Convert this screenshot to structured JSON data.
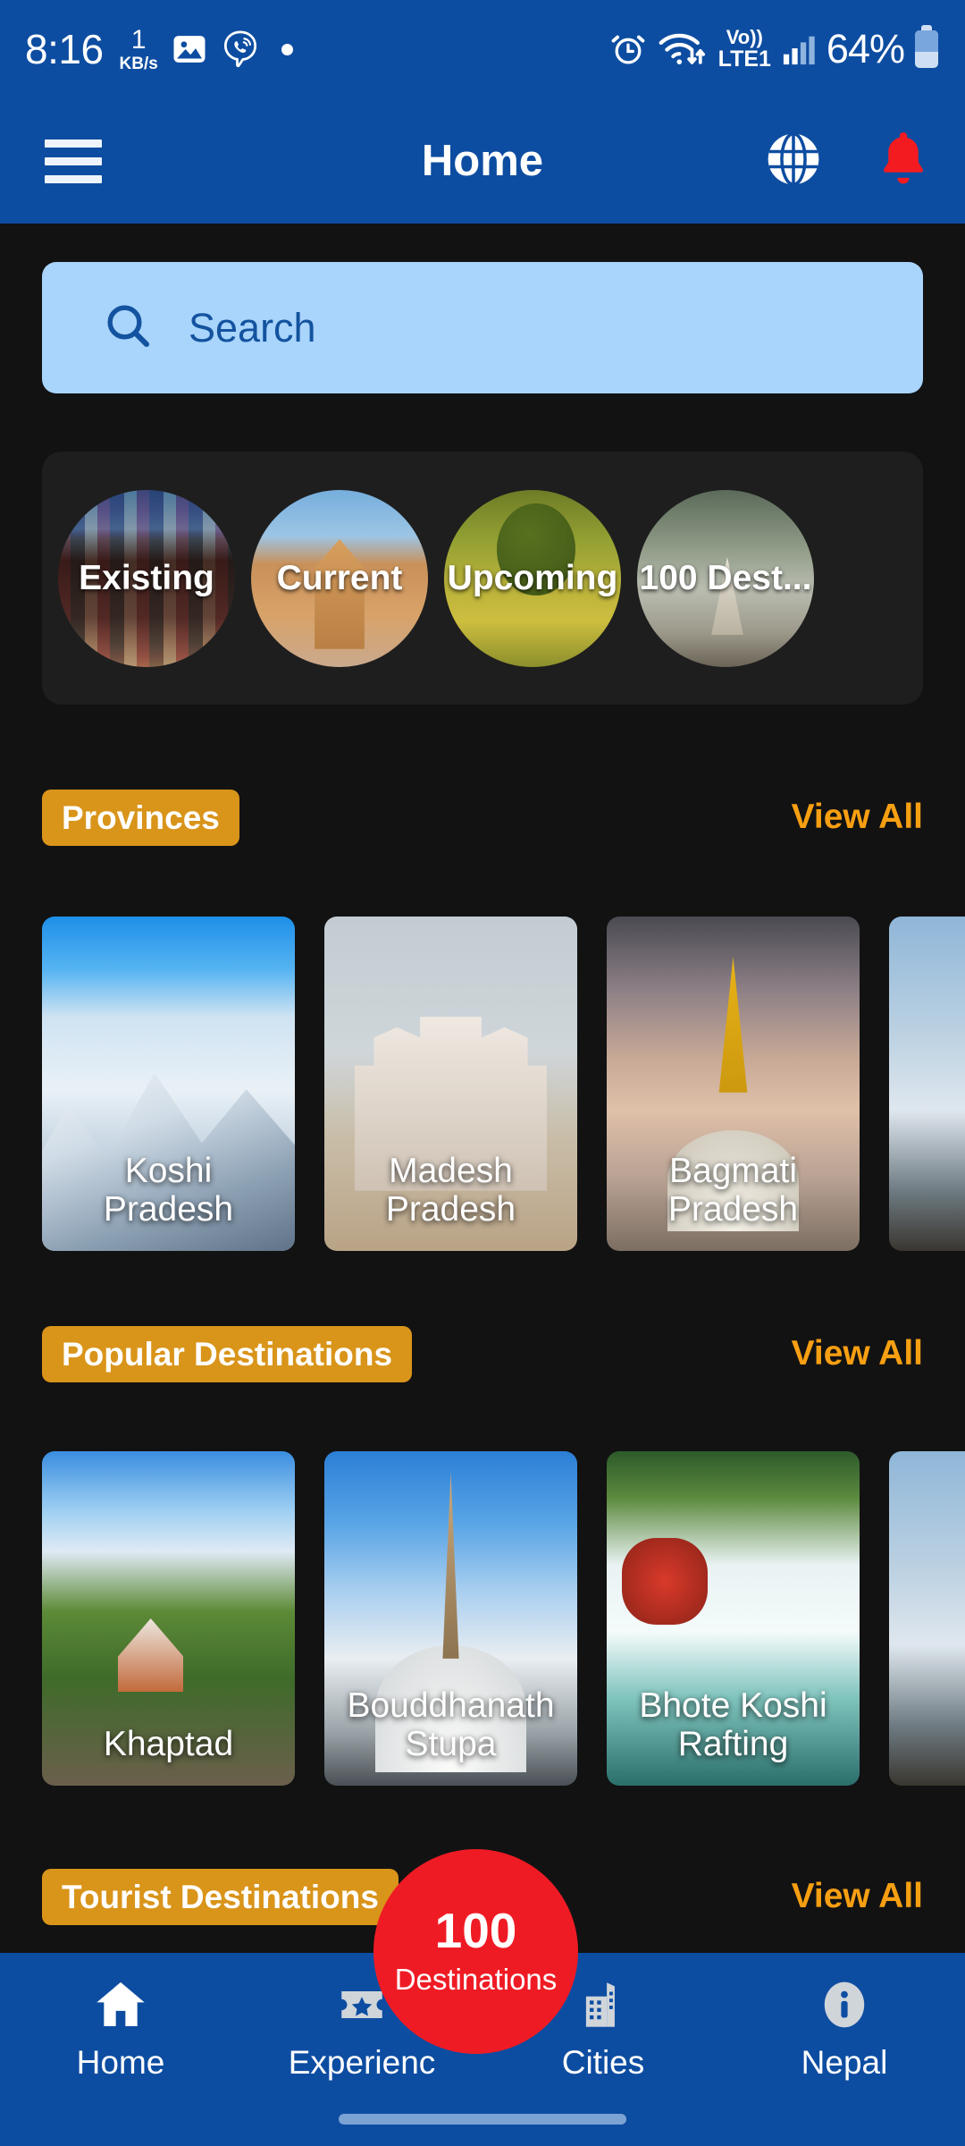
{
  "status_bar": {
    "time": "8:16",
    "net_speed_value": "1",
    "net_speed_unit": "KB/s",
    "icons": [
      "photo-icon",
      "viber-icon",
      "dot-icon"
    ],
    "right_icons": [
      "alarm-icon",
      "wifi-icon",
      "signal-icon"
    ],
    "volte_line1": "Vo))",
    "volte_line2": "LTE1",
    "battery_percent": "64%"
  },
  "appbar": {
    "title": "Home",
    "menu_icon": "hamburger-icon",
    "globe_icon": "globe-icon",
    "bell_icon": "bell-icon",
    "bg_color": "#0d4da1",
    "bell_color": "#f41b20"
  },
  "search": {
    "placeholder": "Search",
    "value": "",
    "icon": "search-icon",
    "bg_color": "#a9d4fb",
    "text_color": "#13539f"
  },
  "categories": [
    {
      "label": "Existing",
      "image": "im-street"
    },
    {
      "label": "Current",
      "image": "im-temple"
    },
    {
      "label": "Upcoming",
      "image": "im-forest"
    },
    {
      "label": "100 Dest...",
      "image": "im-stupa2"
    }
  ],
  "sections": [
    {
      "badge": "Provinces",
      "view_all": "View All",
      "cards": [
        {
          "label": "Koshi\nPradesh",
          "image": "im-koshi"
        },
        {
          "label": "Madesh\nPradesh",
          "image": "im-madesh"
        },
        {
          "label": "Bagmati\nPradesh",
          "image": "im-bagmati"
        },
        {
          "label": "",
          "image": "im-mtn"
        }
      ]
    },
    {
      "badge": "Popular Destinations",
      "view_all": "View All",
      "cards": [
        {
          "label": "Khaptad",
          "image": "im-khaptad"
        },
        {
          "label": "Bouddhanath\nStupa",
          "image": "im-boud"
        },
        {
          "label": "Bhote Koshi\nRafting",
          "image": "im-raft"
        },
        {
          "label": "",
          "image": "im-mtn"
        }
      ]
    },
    {
      "badge": "Tourist Destinations",
      "view_all": "View All",
      "cards": []
    }
  ],
  "fab": {
    "number": "100",
    "label": "Destinations",
    "color": "#ef1b24"
  },
  "bottom_nav": {
    "items": [
      {
        "label": "Home",
        "icon": "home-icon",
        "active": true
      },
      {
        "label": "Experienc",
        "icon": "ticket-star-icon",
        "active": false
      },
      {
        "label": "Cities",
        "icon": "buildings-icon",
        "active": false
      },
      {
        "label": "Nepal",
        "icon": "info-icon",
        "active": false
      }
    ],
    "bg_color": "#0d4da1"
  },
  "theme": {
    "page_bg": "#121212",
    "panel_bg": "#1e1e1e",
    "badge_bg": "#d9941a",
    "accent": "#f79f12"
  }
}
